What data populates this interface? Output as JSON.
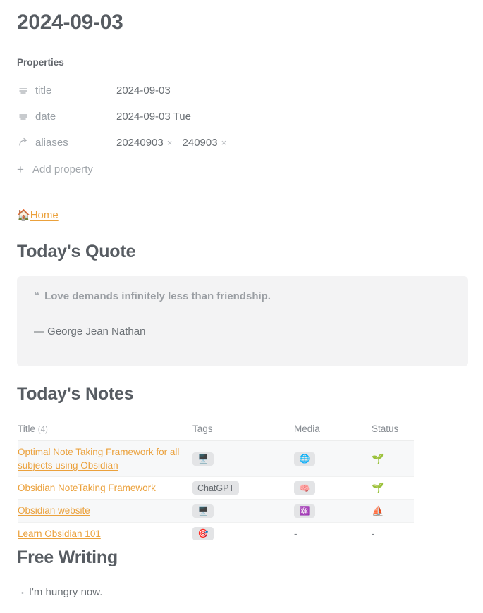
{
  "note": {
    "title": "2024-09-03"
  },
  "properties": {
    "label": "Properties",
    "rows": [
      {
        "icon": "text-lines-icon",
        "key": "title",
        "value": "2024-09-03"
      },
      {
        "icon": "text-lines-icon",
        "key": "date",
        "value": "2024-09-03 Tue"
      }
    ],
    "aliases": {
      "icon": "forward-arrow-icon",
      "key": "aliases",
      "chips": [
        {
          "label": "20240903",
          "remove": "×"
        },
        {
          "label": "240903",
          "remove": "×"
        }
      ]
    },
    "add_property": {
      "plus": "+",
      "label": "Add property"
    }
  },
  "home": {
    "emoji": "🏠",
    "label": "Home"
  },
  "quote_section": {
    "heading": "Today's Quote",
    "quote_mark": "❝",
    "text": "Love demands infinitely less than friendship.",
    "author": "— George Jean Nathan"
  },
  "notes_section": {
    "heading": "Today's Notes",
    "columns": {
      "title": "Title",
      "title_count": "(4)",
      "tags": "Tags",
      "media": "Media",
      "status": "Status"
    },
    "rows": [
      {
        "title": "Optimal Note Taking Framework for all subjects using Obsidian",
        "tag": "🖥️",
        "tag_is_emoji": true,
        "media": "🌐",
        "media_is_emoji": true,
        "status": "🌱"
      },
      {
        "title": "Obsidian NoteTaking Framework",
        "tag": "ChatGPT",
        "tag_is_emoji": false,
        "media": "🧠",
        "media_is_emoji": true,
        "status": "🌱"
      },
      {
        "title": "Obsidian website",
        "tag": "🖥️",
        "tag_is_emoji": true,
        "media": "⚛️",
        "media_is_emoji": true,
        "status": "⛵"
      },
      {
        "title": "Learn Obsidian 101",
        "tag": "🎯",
        "tag_is_emoji": true,
        "media": "-",
        "media_is_emoji": false,
        "status": "-"
      }
    ]
  },
  "free_writing": {
    "heading": "Free Writing",
    "items": [
      {
        "bullet": "•",
        "text": "I'm hungry now."
      }
    ]
  },
  "colors": {
    "link": "#eba13c",
    "heading": "#575c62",
    "callout_bg": "#f3f3f4",
    "pill_bg": "#e3e4e6",
    "row_stripe": "#f7f8f9"
  }
}
